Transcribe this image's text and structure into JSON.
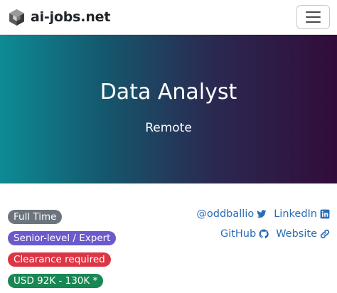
{
  "navbar": {
    "brand": "ai-jobs.net",
    "logo_icon": "cube-logo-icon",
    "menu_icon": "hamburger-menu-icon"
  },
  "hero": {
    "title": "Data Analyst",
    "subtitle": "Remote",
    "gradient_colors": [
      "#0d8b95",
      "#14596e",
      "#2a2a52",
      "#320c3a"
    ]
  },
  "badges": [
    {
      "label": "Full Time",
      "color": "#6c757d"
    },
    {
      "label": "Senior-level / Expert",
      "color": "#6a5acd"
    },
    {
      "label": "Clearance required",
      "color": "#dc3545"
    },
    {
      "label": "USD 92K - 130K *",
      "color": "#198754"
    }
  ],
  "links": {
    "twitter": {
      "label": "@oddballio",
      "icon": "twitter-icon"
    },
    "linkedin": {
      "label": "LinkedIn",
      "icon": "linkedin-icon"
    },
    "github": {
      "label": "GitHub",
      "icon": "github-icon"
    },
    "website": {
      "label": "Website",
      "icon": "link-icon"
    },
    "color": "#2a6db5"
  }
}
